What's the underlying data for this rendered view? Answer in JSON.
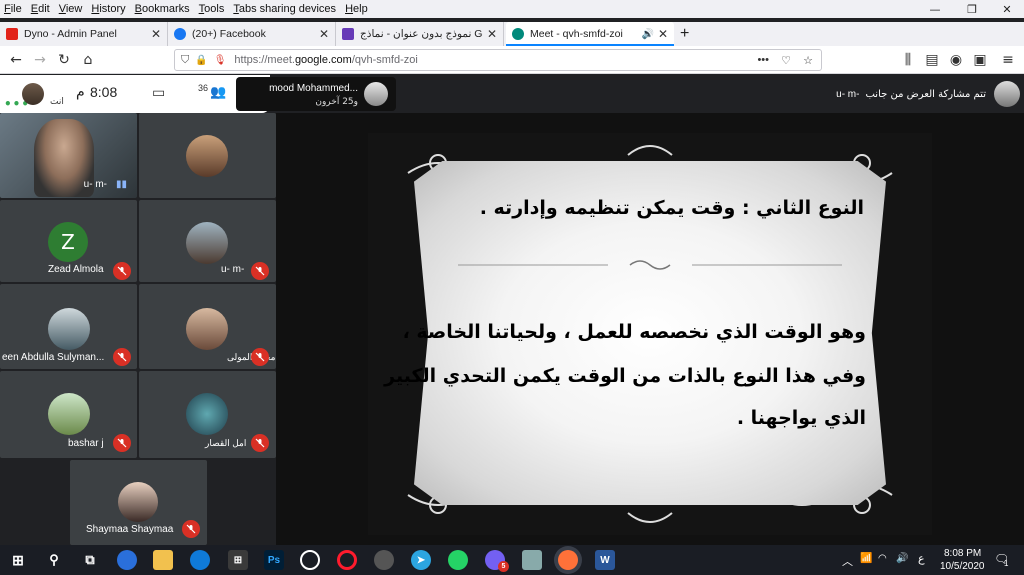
{
  "menu": [
    "File",
    "Edit",
    "View",
    "History",
    "Bookmarks",
    "Tools",
    "Tabs sharing devices",
    "Help"
  ],
  "window_controls": {
    "minimize": "—",
    "restore": "❐",
    "close": "✕"
  },
  "tabs": [
    {
      "title": "Dyno - Admin Panel",
      "color": "#e2231a"
    },
    {
      "title": "(20+) Facebook",
      "color": "#1877f2"
    },
    {
      "title": "نموذج بدون عنوان - نماذج Google",
      "color": "#673ab7"
    },
    {
      "title": "Meet - qvh-smfd-zoi",
      "color": "#00897b"
    }
  ],
  "new_tab": "+",
  "url": {
    "prefix": "https://meet.",
    "domain": "google.com",
    "path": "/qvh-smfd-zoi"
  },
  "meet": {
    "time": "8:08",
    "ampm": "م",
    "participants_count": "36",
    "self_label": "انت",
    "presenter_name": "mood Mohammed...",
    "presenter_others": "و25 آخرون",
    "share_banner": "تتم مشاركة العرض من جانب",
    "share_banner_name": "u- m-",
    "tiles": [
      {
        "name": "u- m-",
        "kind": "video"
      },
      {
        "name": "انت",
        "kind": "self"
      },
      {
        "name": "Zead Almola",
        "initial": "Z",
        "color": "#2e7d32"
      },
      {
        "name": "u- m-",
        "kind": "photo"
      },
      {
        "name": "een Abdulla Sulyman...",
        "kind": "photo"
      },
      {
        "name": "محمد المولى",
        "kind": "photo"
      },
      {
        "name": "bashar j",
        "kind": "photo"
      },
      {
        "name": "امل القصار",
        "kind": "photo"
      },
      {
        "name": "Shaymaa Shaymaa",
        "kind": "photo"
      }
    ],
    "slide": {
      "heading": "النوع الثاني : وقت يمكن تنظيمه وإدارته .",
      "line1": "وهو الوقت الذي نخصصه للعمل ، ولحياتنا الخاصة ،",
      "line2": "وفي هذا النوع بالذات من الوقت يكمن التحدي الكبير",
      "line3": "الذي يواجهنا ."
    }
  },
  "taskbar": {
    "lang": "ع",
    "time": "8:08 PM",
    "date": "10/5/2020",
    "notifications": "1",
    "viber_badge": "5"
  }
}
